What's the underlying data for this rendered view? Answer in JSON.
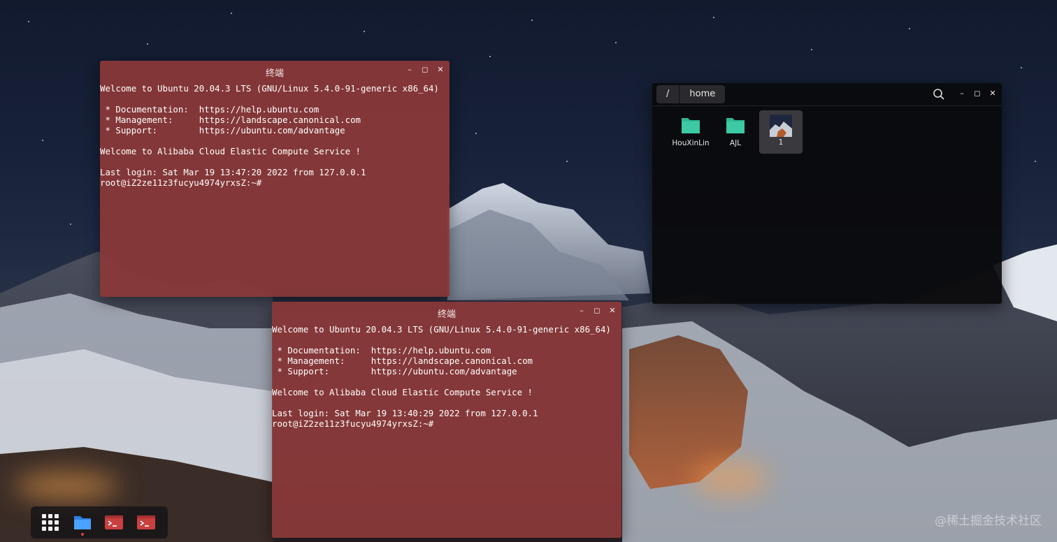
{
  "terminal_top": {
    "title": "终端",
    "lines": "Welcome to Ubuntu 20.04.3 LTS (GNU/Linux 5.4.0-91-generic x86_64)\n\n * Documentation:  https://help.ubuntu.com\n * Management:     https://landscape.canonical.com\n * Support:        https://ubuntu.com/advantage\n\nWelcome to Alibaba Cloud Elastic Compute Service !\n\nLast login: Sat Mar 19 13:47:20 2022 from 127.0.0.1\nroot@iZ2ze11z3fucyu4974yrxsZ:~#"
  },
  "terminal_bottom": {
    "title": "终端",
    "lines": "Welcome to Ubuntu 20.04.3 LTS (GNU/Linux 5.4.0-91-generic x86_64)\n\n * Documentation:  https://help.ubuntu.com\n * Management:     https://landscape.canonical.com\n * Support:        https://ubuntu.com/advantage\n\nWelcome to Alibaba Cloud Elastic Compute Service !\n\nLast login: Sat Mar 19 13:40:29 2022 from 127.0.0.1\nroot@iZ2ze11z3fucyu4974yrxsZ:~#"
  },
  "window_buttons": {
    "minimize": "–",
    "maximize": "◻",
    "close": "✕"
  },
  "file_manager": {
    "breadcrumbs": [
      "/",
      "home"
    ],
    "items": [
      {
        "name": "HouXinLin",
        "type": "folder"
      },
      {
        "name": "AJL",
        "type": "folder"
      },
      {
        "name": "1",
        "type": "image"
      }
    ],
    "folder_color": "#2fb894"
  },
  "dock": {
    "items": [
      "app-grid-icon",
      "files-icon",
      "terminal-icon",
      "terminal-icon"
    ]
  },
  "watermark": "@稀土掘金技术社区",
  "colors": {
    "terminal_bg": "#8a3838",
    "file_manager_bg": "#0a0a0c"
  }
}
